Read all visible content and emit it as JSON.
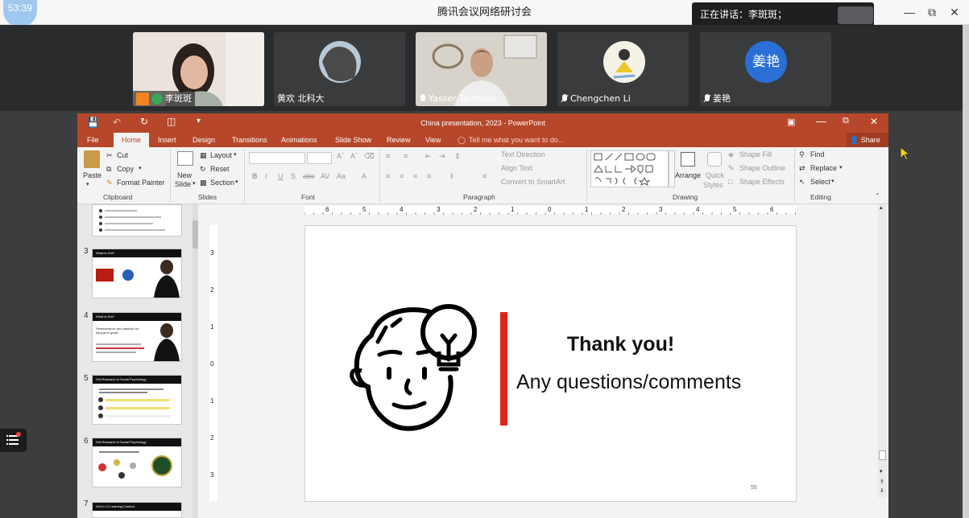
{
  "window": {
    "timer": "53:39",
    "title": "腾讯会议网络研讨会",
    "speaking_label": "正在讲话：李斑斑；"
  },
  "participants": [
    {
      "name": "李斑斑",
      "host": true
    },
    {
      "name": "黄欢 北科大"
    },
    {
      "name": "Yasser Teimouri"
    },
    {
      "name": "Chengchen Li"
    },
    {
      "name": "姜艳",
      "avatar_text": "姜艳"
    }
  ],
  "powerpoint": {
    "title": "China presentation, 2023  -  PowerPoint",
    "tabs": [
      "File",
      "Home",
      "Insert",
      "Design",
      "Transitions",
      "Animations",
      "Slide Show",
      "Review",
      "View"
    ],
    "tell_me": "Tell me what you want to do...",
    "share": "Share",
    "clipboard": {
      "paste": "Paste",
      "cut": "Cut",
      "copy": "Copy",
      "format_painter": "Format Painter",
      "group": "Clipboard"
    },
    "slides_group": {
      "new_slide": "New",
      "new_slide2": "Slide",
      "layout": "Layout",
      "reset": "Reset",
      "section": "Section",
      "group": "Slides"
    },
    "font_group": "Font",
    "paragraph": {
      "text_direction": "Text Direction",
      "align_text": "Align Text",
      "convert_smartart": "Convert to SmartArt",
      "group": "Paragraph"
    },
    "drawing": {
      "arrange": "Arrange",
      "quick_styles": "Quick",
      "quick_styles2": "Styles",
      "shape_fill": "Shape Fill",
      "shape_outline": "Shape Outline",
      "shape_effects": "Shape Effects",
      "group": "Drawing"
    },
    "editing": {
      "find": "Find",
      "replace": "Replace",
      "select": "Select",
      "group": "Editing"
    },
    "thumb_numbers": [
      "3",
      "4",
      "5",
      "6",
      "7"
    ],
    "thumb_titles": [
      "What is Grit?",
      "What is Grit?",
      "Grit Research in Social Psychology",
      "Grit Research in Social Psychology",
      "Grit in L2 Learning Context"
    ],
    "thumb4_sub": "Perseverance and passion for long-term goals",
    "ruler_numbers": [
      "6",
      "5",
      "4",
      "3",
      "2",
      "1",
      "0",
      "1",
      "2",
      "3",
      "4",
      "5",
      "6"
    ],
    "vruler_numbers": [
      "3",
      "2",
      "1",
      "0",
      "1",
      "2",
      "3"
    ],
    "slide": {
      "heading": "Thank you!",
      "subtitle": "Any questions/comments",
      "page_number": "55",
      "accent_color": "#e0241b"
    }
  }
}
